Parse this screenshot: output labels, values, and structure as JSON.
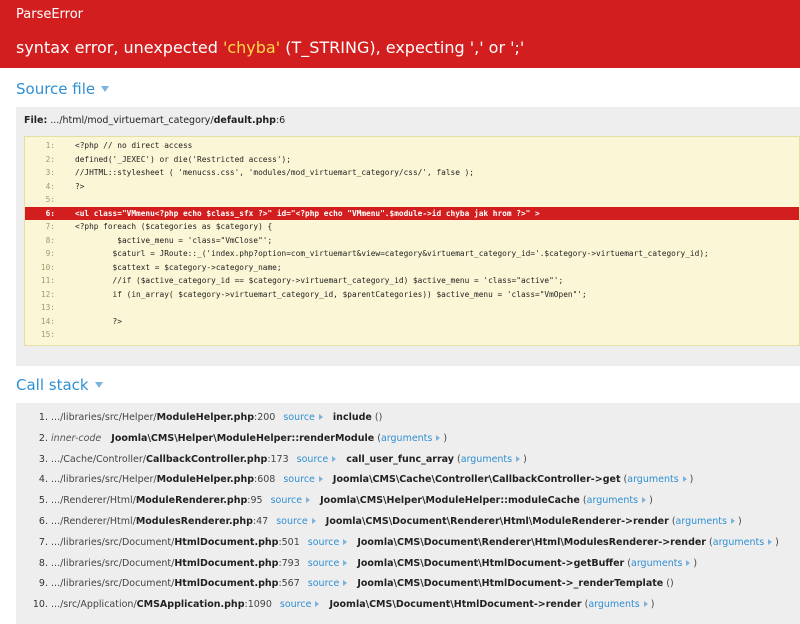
{
  "header": {
    "error_class": "ParseError",
    "message_pre": "syntax error, unexpected ",
    "message_token": "'chyba'",
    "message_post": " (T_STRING), expecting ',' or ';'"
  },
  "source": {
    "section_title": "Source file",
    "file_label": "File:",
    "file_path": " .../html/mod_virtuemart_category/",
    "file_name": "default.php",
    "file_line": ":6",
    "lines": [
      {
        "num": "1:",
        "text": "<?php // no direct access"
      },
      {
        "num": "2:",
        "text": "defined('_JEXEC') or die('Restricted access');"
      },
      {
        "num": "3:",
        "text": "//JHTML::stylesheet ( 'menucss.css', 'modules/mod_virtuemart_category/css/', false );"
      },
      {
        "num": "4:",
        "text": "?>"
      },
      {
        "num": "5:",
        "text": ""
      },
      {
        "num": "6:",
        "text": "<ul class=\"VMmenu<?php echo $class_sfx ?>\" id=\"<?php echo \"VMmenu\".$module->id chyba jak hrom ?>\" >"
      },
      {
        "num": "7:",
        "text": "<?php foreach ($categories as $category) {"
      },
      {
        "num": "8:",
        "text": "         $active_menu = 'class=\"VmClose\"';"
      },
      {
        "num": "9:",
        "text": "        $caturl = JRoute::_('index.php?option=com_virtuemart&view=category&virtuemart_category_id='.$category->virtuemart_category_id);"
      },
      {
        "num": "10:",
        "text": "        $cattext = $category->category_name;"
      },
      {
        "num": "11:",
        "text": "        //if ($active_category_id == $category->virtuemart_category_id) $active_menu = 'class=\"active\"';"
      },
      {
        "num": "12:",
        "text": "        if (in_array( $category->virtuemart_category_id, $parentCategories)) $active_menu = 'class=\"VmOpen\"';"
      },
      {
        "num": "13:",
        "text": ""
      },
      {
        "num": "14:",
        "text": "        ?>"
      },
      {
        "num": "15:",
        "text": ""
      }
    ]
  },
  "stack": {
    "section_title": "Call stack",
    "source_label": "source",
    "arguments_label": "arguments",
    "frames": [
      {
        "idx": "1.",
        "inner": "",
        "path": ".../libraries/src/Helper/",
        "file": "ModuleHelper.php",
        "line": ":200",
        "has_source": true,
        "fn": "include",
        "has_args": false
      },
      {
        "idx": "2.",
        "inner": "inner-code",
        "path": "",
        "file": "",
        "line": "",
        "has_source": false,
        "fn": "Joomla\\CMS\\Helper\\ModuleHelper::renderModule",
        "has_args": true
      },
      {
        "idx": "3.",
        "inner": "",
        "path": ".../Cache/Controller/",
        "file": "CallbackController.php",
        "line": ":173",
        "has_source": true,
        "fn": "call_user_func_array",
        "has_args": true
      },
      {
        "idx": "4.",
        "inner": "",
        "path": ".../libraries/src/Helper/",
        "file": "ModuleHelper.php",
        "line": ":608",
        "has_source": true,
        "fn": "Joomla\\CMS\\Cache\\Controller\\CallbackController->get",
        "has_args": true
      },
      {
        "idx": "5.",
        "inner": "",
        "path": ".../Renderer/Html/",
        "file": "ModuleRenderer.php",
        "line": ":95",
        "has_source": true,
        "fn": "Joomla\\CMS\\Helper\\ModuleHelper::moduleCache",
        "has_args": true
      },
      {
        "idx": "6.",
        "inner": "",
        "path": ".../Renderer/Html/",
        "file": "ModulesRenderer.php",
        "line": ":47",
        "has_source": true,
        "fn": "Joomla\\CMS\\Document\\Renderer\\Html\\ModuleRenderer->render",
        "has_args": true
      },
      {
        "idx": "7.",
        "inner": "",
        "path": ".../libraries/src/Document/",
        "file": "HtmlDocument.php",
        "line": ":501",
        "has_source": true,
        "fn": "Joomla\\CMS\\Document\\Renderer\\Html\\ModulesRenderer->render",
        "has_args": true
      },
      {
        "idx": "8.",
        "inner": "",
        "path": ".../libraries/src/Document/",
        "file": "HtmlDocument.php",
        "line": ":793",
        "has_source": true,
        "fn": "Joomla\\CMS\\Document\\HtmlDocument->getBuffer",
        "has_args": true
      },
      {
        "idx": "9.",
        "inner": "",
        "path": ".../libraries/src/Document/",
        "file": "HtmlDocument.php",
        "line": ":567",
        "has_source": true,
        "fn": "Joomla\\CMS\\Document\\HtmlDocument->_renderTemplate",
        "has_args": false
      },
      {
        "idx": "10.",
        "inner": "",
        "path": ".../src/Application/",
        "file": "CMSApplication.php",
        "line": ":1090",
        "has_source": true,
        "fn": "Joomla\\CMS\\Document\\HtmlDocument->render",
        "has_args": true
      }
    ]
  },
  "colors": {
    "header_bg": "#d21e1e",
    "highlight_token": "#ffd84a",
    "link_blue": "#2f8fd3",
    "code_bg": "#fbf6d6"
  }
}
